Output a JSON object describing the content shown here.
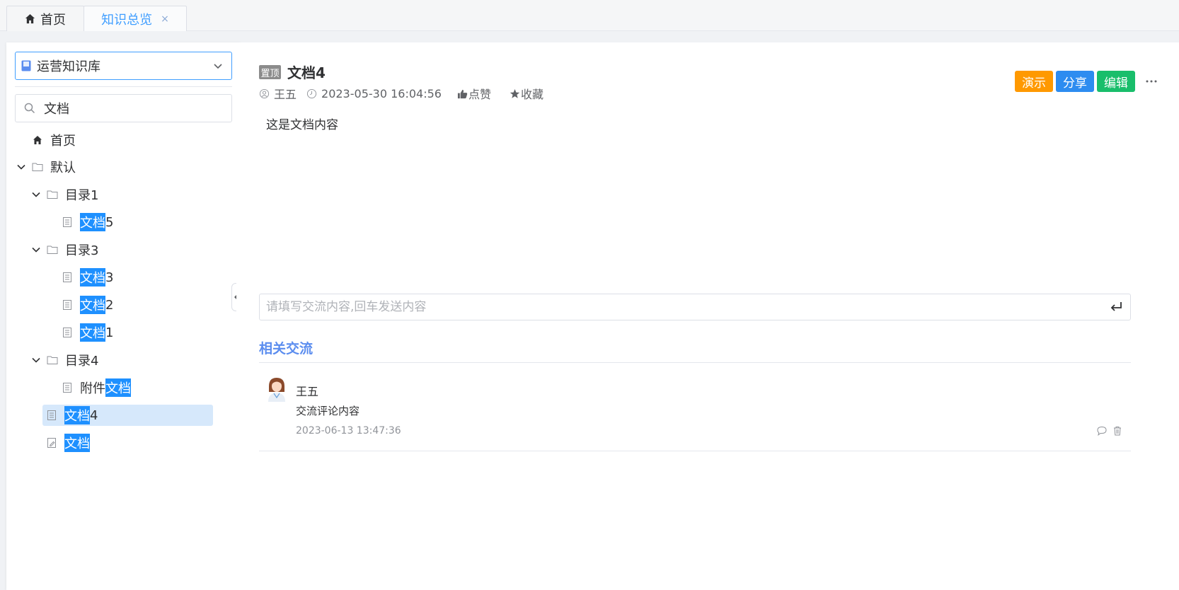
{
  "tabs": [
    {
      "label": "首页",
      "icon": "home-icon"
    },
    {
      "label": "知识总览",
      "closable": true,
      "close_glyph": "×",
      "active": true
    }
  ],
  "sidebar": {
    "knowledge_base": "运营知识库",
    "search_value": "文档",
    "tree": {
      "home": "首页",
      "default_folder": "默认",
      "dir1": "目录1",
      "doc5_suffix": "5",
      "dir3": "目录3",
      "doc3_suffix": "3",
      "doc2_suffix": "2",
      "doc1_suffix": "1",
      "dir4": "目录4",
      "attach_prefix": "附件",
      "doc4_suffix": "4",
      "highlight": "文档"
    }
  },
  "document": {
    "pin_badge": "置顶",
    "title": "文档4",
    "author": "王五",
    "created": "2023-05-30 16:04:56",
    "like_label": "点赞",
    "favorite_label": "收藏",
    "actions": {
      "present": "演示",
      "share": "分享",
      "edit": "编辑"
    },
    "content": "这是文档内容"
  },
  "comments": {
    "input_placeholder": "请填写交流内容,回车发送内容",
    "section_title": "相关交流",
    "items": [
      {
        "user": "王五",
        "text": "交流评论内容",
        "time": "2023-06-13 13:47:36"
      }
    ]
  },
  "colors": {
    "accent": "#409eff",
    "highlight": "#1e90ff",
    "present": "#ff9900",
    "share": "#2d8cf0",
    "edit": "#19be6b",
    "section_title": "#5b8def"
  }
}
